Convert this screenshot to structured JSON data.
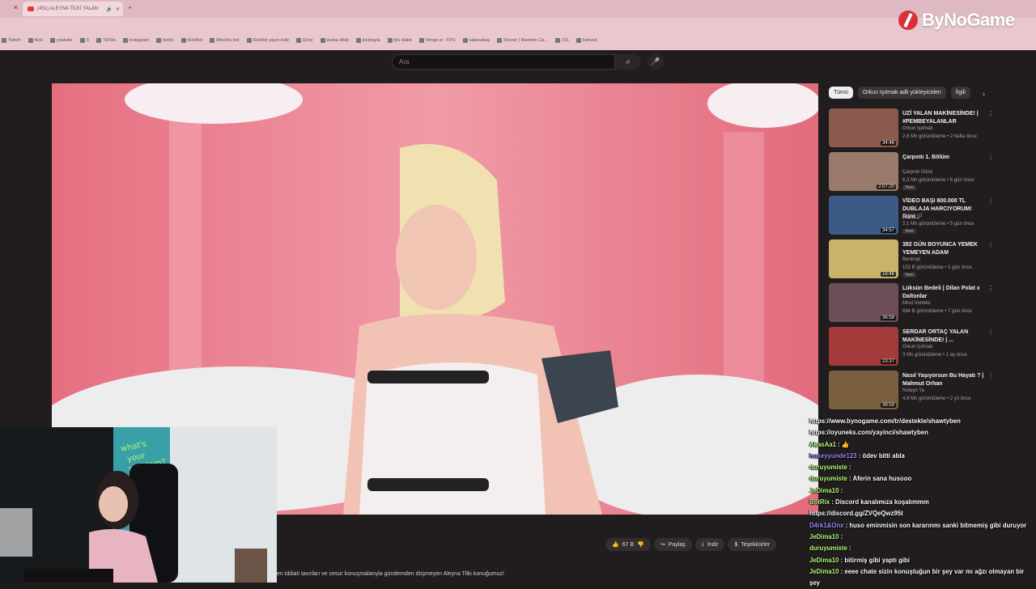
{
  "browser": {
    "tab_title": "(451) ALEYNA TİLKİ YALAN",
    "bookmarks": [
      "Twitch",
      "Kick",
      "youtube",
      "X",
      "TikTok",
      "instagram",
      "botrix",
      "KickBot",
      "MissXtc bot",
      "Kickbot yayın indir",
      "Envy",
      "araba ölküt",
      "kirahayla",
      "fps stabit",
      "Venge.io - FPS",
      "sakarabaş",
      "Soccer | Manbon Ca...",
      "101",
      "kahvıot"
    ]
  },
  "branding": {
    "logo_text": "ByNoGame"
  },
  "youtube": {
    "search_placeholder": "Ara",
    "chips": [
      "Tümü",
      "Orkun Işıtmak adlı yükleyiciden",
      "İlgili"
    ],
    "actions": {
      "likes": "67 B",
      "share": "Paylaş",
      "download": "İndir",
      "thanks": "Teşekkürler"
    },
    "description_snippet": "en iddialı tavırları ve cesur konuşmalarıyla gündemden düşmeyen Aleyna Tilki konuğumuz!",
    "recommendations": [
      {
        "title": "UZİ YALAN MAKİNESİNDE! | #PEMBEYALANLAR",
        "channel": "Orkun Işıtmak",
        "meta": "2,6 Mn görüntüleme • 2 hafta önce",
        "duration": "34:46",
        "new": ""
      },
      {
        "title": "Çarpıntı 1. Bölüm",
        "channel": "Çarpıntı Dizisi",
        "meta": "6,3 Mn görüntüleme • 6 gün önce",
        "duration": "2:07:20",
        "new": "Yeni"
      },
      {
        "title": "VİDEO BAŞI 800.000 TL DUBLAJA HARCIYORUM! Ruhi...",
        "channel": "Orkun v2",
        "meta": "2,1 Mn görüntüleme • 5 gün önce",
        "duration": "34:57",
        "new": "Yeni"
      },
      {
        "title": "382 GÜN BOYUNCA YEMEK YEMEYEN ADAM",
        "channel": "Bentropi",
        "meta": "102 B görüntüleme • 1 gün önce",
        "duration": "16:46",
        "new": "Yeni"
      },
      {
        "title": "Lüksün Bedeli | Dilan Polat x Daltonlar",
        "channel": "Mind Vortekx",
        "meta": "694 B görüntüleme • 7 gün önce",
        "duration": "36:58",
        "new": ""
      },
      {
        "title": "SERDAR ORTAÇ YALAN MAKİNESİNDE! | ...",
        "channel": "Orkun Işıtmak",
        "meta": "3 Mn görüntüleme • 1 ay önce",
        "duration": "23:37",
        "new": ""
      },
      {
        "title": "Nasıl Yaşıyorsun Bu Hayatı ? | Mahmut Orhan",
        "channel": "Nolayo Ya",
        "meta": "4,9 Mn görüntüleme • 2 yıl önce",
        "duration": "39:59",
        "new": ""
      }
    ]
  },
  "chat_overlay": [
    {
      "name": "",
      "text": "https://www.bynogame.com/tr/destekle/shawtyben"
    },
    {
      "name": "",
      "text": "https://oyuneks.com/yayinci/shawtyben"
    },
    {
      "name": "AkasAa1",
      "text": ": 👍"
    },
    {
      "name": "huseyyunde123",
      "text": ": ödev bitti abla"
    },
    {
      "name": "duruyumiste",
      "text": ":"
    },
    {
      "name": "duruyumiste",
      "text": ": Aferin sana husooo"
    },
    {
      "name": "JeDima10",
      "text": ":"
    },
    {
      "name": "BotRix",
      "text": ": Discord kanalımıza koşalımmm"
    },
    {
      "name": "",
      "text": "https://discord.gg/ZVQeQwz95t"
    },
    {
      "name": "D4rk1&Onx",
      "text": ": huso eminmisin son kararınmı sanki bitmemiş gibi duruyor"
    },
    {
      "name": "JeDima10",
      "text": ":"
    },
    {
      "name": "duruyumiste",
      "text": ":"
    },
    {
      "name": "JeDima10",
      "text": ": bitirmiş gibi yaptı gibi"
    },
    {
      "name": "JeDima10",
      "text": ": eeee chate sizin konuştuğun bir şey var mı ağzı olmayan bir şey"
    }
  ],
  "colors": {
    "accent_pink": "#dfb9c1",
    "video_bg": "#e88a96",
    "yt_dark": "#211c1d"
  }
}
